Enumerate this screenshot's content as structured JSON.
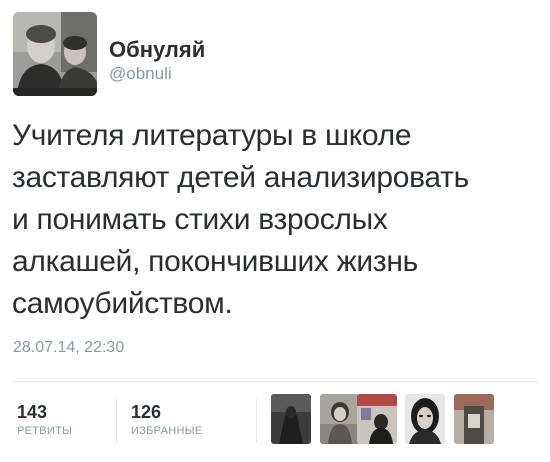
{
  "user": {
    "display_name": "Обнуляй",
    "handle": "@obnuli"
  },
  "tweet": {
    "lines": [
      "Учителя литературы в школе",
      "заставляют детей анализировать",
      "и понимать стихи взрослых",
      "алкашей, покончивших жизнь",
      "самоубийством."
    ],
    "timestamp": "28.07.14, 22:30"
  },
  "stats": {
    "retweets": {
      "count": "143",
      "label": "РЕТВИТЫ"
    },
    "favorites": {
      "count": "126",
      "label": "ИЗБРАННЫЕ"
    }
  },
  "favoriters": [
    "avatar-1",
    "avatar-2",
    "avatar-3",
    "avatar-4",
    "avatar-5"
  ],
  "colors": {
    "text": "#292f33",
    "muted": "#8899a6",
    "divider": "#e1e8ed"
  }
}
